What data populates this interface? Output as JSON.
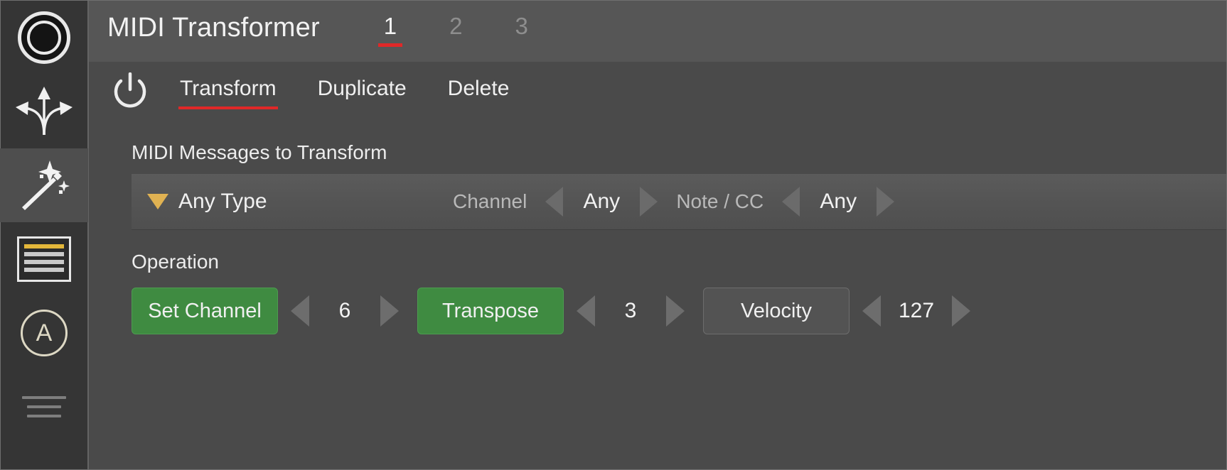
{
  "sidebar": {
    "items": [
      {
        "name": "record-icon",
        "label": "Record"
      },
      {
        "name": "routing-icon",
        "label": "Routing"
      },
      {
        "name": "magic-wand-icon",
        "label": "Transformer",
        "active": true
      },
      {
        "name": "event-list-icon",
        "label": "Event List"
      },
      {
        "name": "auto-a-icon",
        "label": "A",
        "glyph": "A"
      },
      {
        "name": "menu-stack-icon",
        "label": "Menu"
      }
    ]
  },
  "header": {
    "title": "MIDI Transformer",
    "slot_tabs": [
      {
        "label": "1",
        "active": true
      },
      {
        "label": "2",
        "active": false
      },
      {
        "label": "3",
        "active": false
      }
    ]
  },
  "modebar": {
    "power_icon": "power-icon",
    "tabs": [
      {
        "label": "Transform",
        "active": true
      },
      {
        "label": "Duplicate",
        "active": false
      },
      {
        "label": "Delete",
        "active": false
      }
    ]
  },
  "messages_section": {
    "title": "MIDI Messages to Transform",
    "type_selector": {
      "value": "Any Type",
      "caret": "triangle-down-icon"
    },
    "fields": [
      {
        "name": "Channel",
        "value": "Any"
      },
      {
        "name": "Note / CC",
        "value": "Any"
      }
    ]
  },
  "operation_section": {
    "title": "Operation",
    "operations": [
      {
        "label": "Set Channel",
        "enabled": true,
        "value": "6"
      },
      {
        "label": "Transpose",
        "enabled": true,
        "value": "3"
      },
      {
        "label": "Velocity",
        "enabled": false,
        "value": "127"
      }
    ]
  },
  "colors": {
    "background": "#4a4a4a",
    "header_background": "#565656",
    "sidebar_background": "#353535",
    "accent_red": "#e02828",
    "accent_green": "#3f8b41",
    "accent_amber": "#e0b252",
    "text_primary": "#f1f1f1",
    "text_muted": "#8e8e8e"
  }
}
